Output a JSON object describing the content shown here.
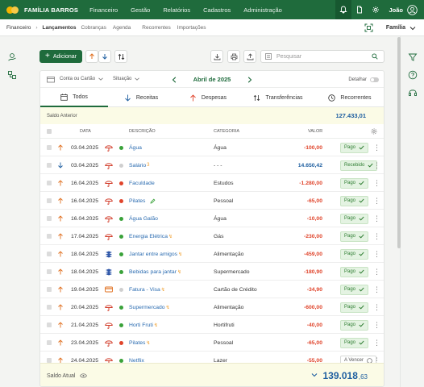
{
  "brand": {
    "name": "FAMÍLIA BARROS"
  },
  "topnav": [
    "Financeiro",
    "Gestão",
    "Relatórios",
    "Cadastros",
    "Administração"
  ],
  "user": {
    "name": "João"
  },
  "breadcrumb": {
    "root": "Financeiro",
    "current": "Lançamentos"
  },
  "subnav": [
    "Cobranças",
    "Agenda",
    "Recorrentes",
    "Importações"
  ],
  "family_selector": "Família",
  "toolbar": {
    "add_label": "Adicionar",
    "search_placeholder": "Pesquisar"
  },
  "filters": {
    "account": "Conta ou Cartão",
    "status": "Situação",
    "month": "Abril de 2025",
    "detail": "Detalhar"
  },
  "tabs": [
    "Todos",
    "Receitas",
    "Despesas",
    "Transferências",
    "Recorrentes"
  ],
  "previous_balance": {
    "label": "Saldo Anterior",
    "value": "127.433,01"
  },
  "columns": {
    "date": "DATA",
    "description": "DESCRIÇÃO",
    "category": "CATEGORIA",
    "value": "VALOR"
  },
  "rows": [
    {
      "date": "03.04.2025",
      "type": "expense",
      "account": "umbrella",
      "dot": "#3aa23a",
      "desc": "Água",
      "mark": "",
      "cat": "Água",
      "val": "-100,00",
      "status": "Pago",
      "paid": true
    },
    {
      "date": "03.04.2025",
      "type": "income",
      "account": "umbrella",
      "dot": "#cfcfcf",
      "desc": "Salário",
      "mark": "3",
      "cat": "- - -",
      "val": "14.650,42",
      "status": "Recebido",
      "paid": true
    },
    {
      "date": "16.04.2025",
      "type": "expense",
      "account": "umbrella",
      "dot": "#e0442b",
      "desc": "Faculdade",
      "mark": "",
      "cat": "Estudos",
      "val": "-1.280,00",
      "status": "Pago",
      "paid": true
    },
    {
      "date": "16.04.2025",
      "type": "expense",
      "account": "umbrella",
      "dot": "#e0442b",
      "desc": "Pilates",
      "mark": "",
      "cat": "Pessoal",
      "val": "-65,00",
      "status": "Pago",
      "paid": true,
      "edit": true
    },
    {
      "date": "16.04.2025",
      "type": "expense",
      "account": "umbrella",
      "dot": "#3aa23a",
      "desc": "Água Galão",
      "mark": "",
      "cat": "Água",
      "val": "-10,00",
      "status": "Pago",
      "paid": true
    },
    {
      "date": "17.04.2025",
      "type": "expense",
      "account": "umbrella",
      "dot": "#3aa23a",
      "desc": "Energia Elétrica",
      "mark": "↯",
      "cat": "Gás",
      "val": "-230,00",
      "status": "Pago",
      "paid": true
    },
    {
      "date": "18.04.2025",
      "type": "expense",
      "account": "bank",
      "dot": "#3aa23a",
      "desc": "Jantar entre amigos",
      "mark": "↯",
      "cat": "Alimentação",
      "val": "-459,00",
      "status": "Pago",
      "paid": true
    },
    {
      "date": "18.04.2025",
      "type": "expense",
      "account": "bank",
      "dot": "#3aa23a",
      "desc": "Bebidas para jantar",
      "mark": "↯",
      "cat": "Supermercado",
      "val": "-180,90",
      "status": "Pago",
      "paid": true
    },
    {
      "date": "19.04.2025",
      "type": "expense",
      "account": "card",
      "dot": "#cfcfcf",
      "desc": "Fatura - Visa",
      "mark": "↯",
      "cat": "Cartão de Crédito",
      "val": "-34,90",
      "status": "Pago",
      "paid": true
    },
    {
      "date": "20.04.2025",
      "type": "expense",
      "account": "umbrella",
      "dot": "#3aa23a",
      "desc": "Supermercado",
      "mark": "↯",
      "cat": "Alimentação",
      "val": "-600,00",
      "status": "Pago",
      "paid": true
    },
    {
      "date": "21.04.2025",
      "type": "expense",
      "account": "umbrella",
      "dot": "#3aa23a",
      "desc": "Horti Fruti",
      "mark": "↯",
      "cat": "Hortifruti",
      "val": "-40,00",
      "status": "Pago",
      "paid": true
    },
    {
      "date": "23.04.2025",
      "type": "expense",
      "account": "umbrella",
      "dot": "#e0442b",
      "desc": "Pilates",
      "mark": "↯",
      "cat": "Pessoal",
      "val": "-65,00",
      "status": "Pago",
      "paid": true
    },
    {
      "date": "24.04.2025",
      "type": "expense",
      "account": "umbrella",
      "dot": "#3aa23a",
      "desc": "Netflix",
      "mark": "",
      "cat": "Lazer",
      "val": "-55,00",
      "status": "A Vencer",
      "paid": false
    }
  ],
  "current_balance": {
    "label": "Saldo Atual",
    "int": "139.018",
    "dec": ",63"
  },
  "colors": {
    "brand": "#1f6b3c",
    "negative": "#e0442b",
    "positive": "#1f5fa0",
    "accent_yellow": "#fbfbe6"
  }
}
